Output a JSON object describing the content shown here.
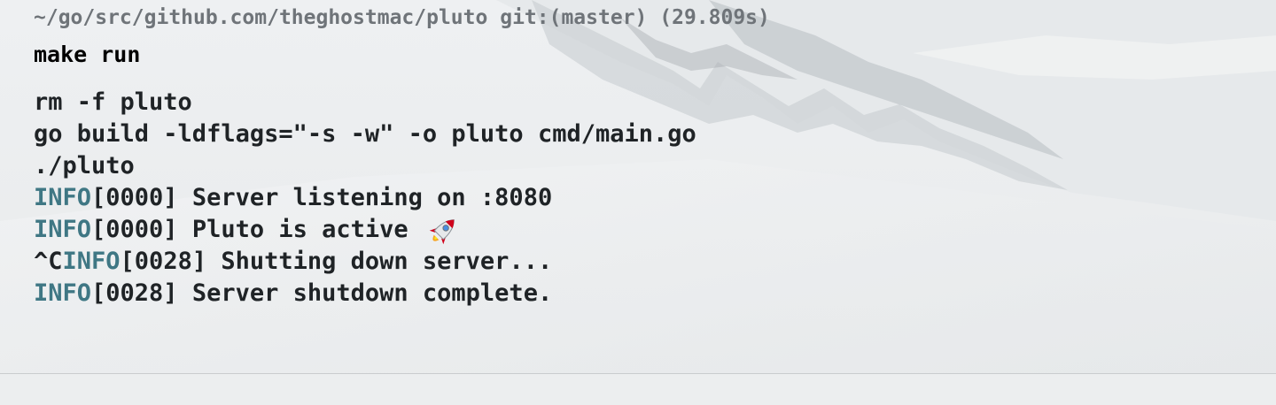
{
  "prompt": {
    "path": "~/go/src/github.com/theghostmac/pluto",
    "git": "git:(master)",
    "duration": "(29.809s)"
  },
  "command": "make run",
  "output_lines": [
    {
      "text": "rm -f pluto"
    },
    {
      "text": "go build -ldflags=\"-s -w\" -o pluto cmd/main.go"
    },
    {
      "text": "./pluto"
    },
    {
      "prefix": "",
      "level": "INFO",
      "rest": "[0000] Server listening on :8080"
    },
    {
      "prefix": "",
      "level": "INFO",
      "rest": "[0000] Pluto is active ",
      "emoji": "rocket-icon"
    },
    {
      "prefix": "^C",
      "level": "INFO",
      "rest": "[0028] Shutting down server..."
    },
    {
      "prefix": "",
      "level": "INFO",
      "rest": "[0028] Server shutdown complete."
    }
  ],
  "colors": {
    "info": "#3f7784",
    "prompt": "#6f7479",
    "text": "#1f2326",
    "command": "#000000"
  }
}
